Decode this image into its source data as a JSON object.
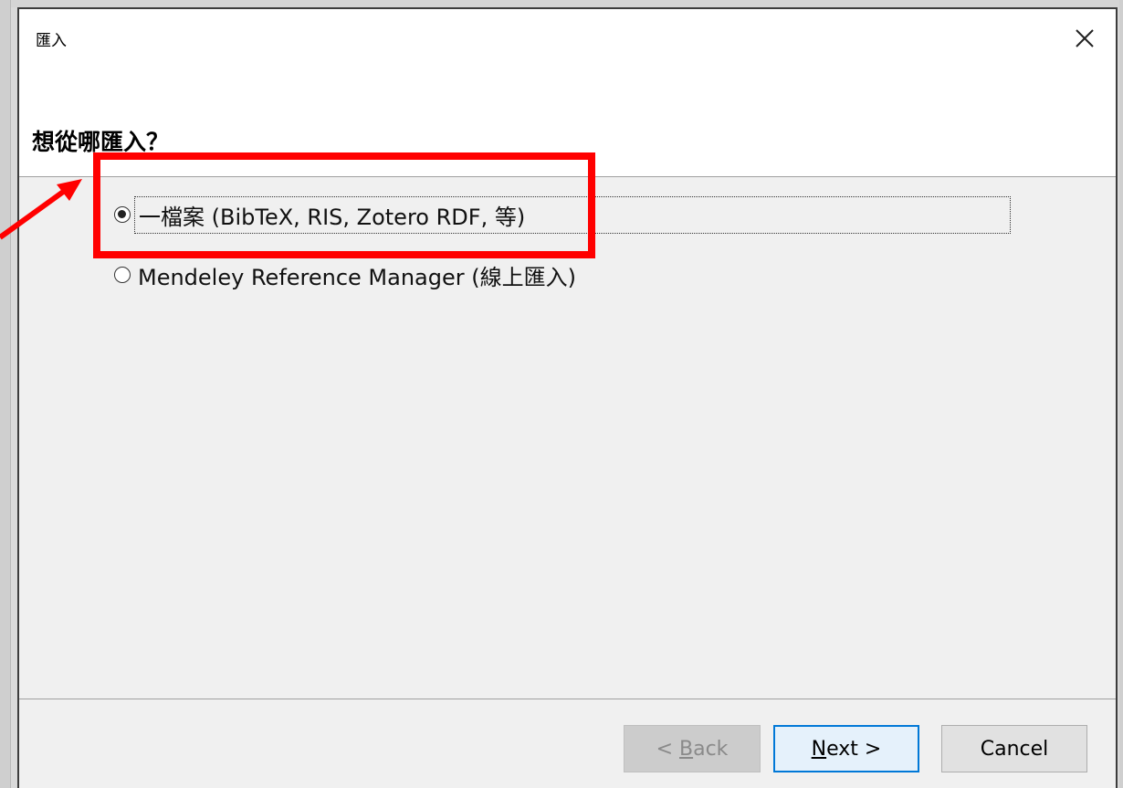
{
  "window": {
    "title": "匯入"
  },
  "dialog": {
    "heading": "想從哪匯入？",
    "options": [
      {
        "label": "一檔案 (BibTeX, RIS, Zotero RDF, 等)",
        "selected": true
      },
      {
        "label": "Mendeley Reference Manager (線上匯入)",
        "selected": false
      }
    ]
  },
  "buttons": {
    "back": {
      "prefix": "< ",
      "accel": "B",
      "rest": "ack",
      "enabled": false
    },
    "next": {
      "accel": "N",
      "rest": "ext >",
      "enabled": true
    },
    "cancel": {
      "label": "Cancel",
      "enabled": true
    }
  },
  "colors": {
    "annotation": "#ff0000",
    "focus_border": "#0078d7"
  },
  "icons": {
    "close": "close-icon"
  }
}
